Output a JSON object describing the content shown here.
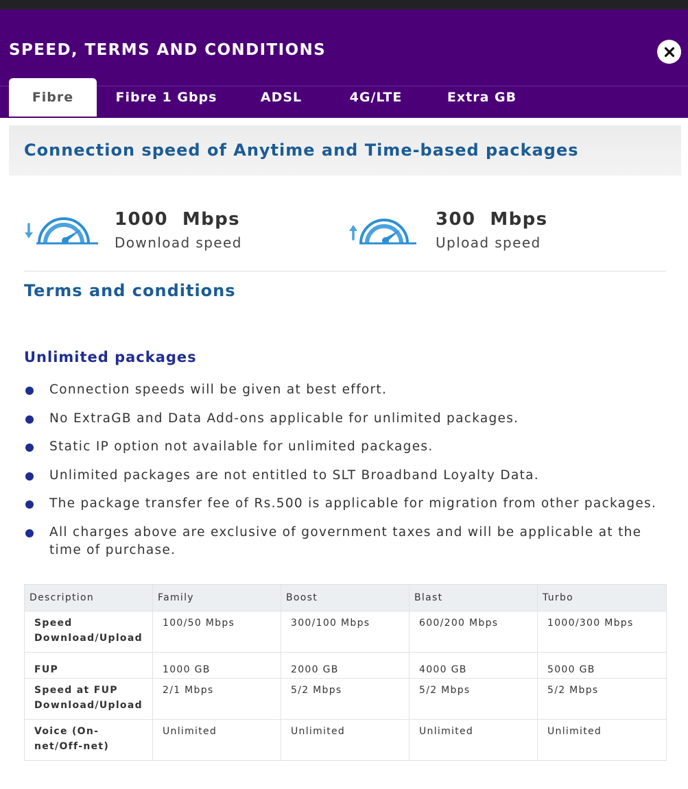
{
  "header": {
    "title": "SPEED, TERMS AND CONDITIONS",
    "close_label": "×"
  },
  "tabs": [
    {
      "label": "Fibre",
      "active": true
    },
    {
      "label": "Fibre 1 Gbps",
      "active": false
    },
    {
      "label": "ADSL",
      "active": false
    },
    {
      "label": "4G/LTE",
      "active": false
    },
    {
      "label": "Extra GB",
      "active": false
    }
  ],
  "section": {
    "heading": "Connection speed of Anytime and Time-based packages"
  },
  "speeds": {
    "download": {
      "value": "1000  Mbps",
      "label": "Download speed",
      "icon": "download-speed-gauge-icon"
    },
    "upload": {
      "value": "300  Mbps",
      "label": "Upload speed",
      "icon": "upload-speed-gauge-icon"
    }
  },
  "terms": {
    "title": "Terms and conditions",
    "unlimited_title": "Unlimited packages",
    "bullets": [
      "Connection speeds will be given at best effort.",
      "No ExtraGB and Data Add-ons applicable for unlimited packages.",
      "Static IP option not available for unlimited packages.",
      "Unlimited packages are not entitled to SLT Broadband Loyalty Data.",
      "The package transfer fee of Rs.500 is applicable for migration from other packages.",
      "All charges above are exclusive of government taxes and will be applicable at the time of purchase."
    ]
  },
  "table": {
    "headers": [
      "Description",
      "Family",
      "Boost",
      "Blast",
      "Turbo"
    ],
    "rows": [
      [
        "Speed Download/Upload",
        "100/50 Mbps",
        "300/100 Mbps",
        "600/200 Mbps",
        "1000/300 Mbps"
      ],
      [
        "FUP",
        "1000 GB",
        "2000 GB",
        "4000 GB",
        "5000 GB"
      ],
      [
        "Speed at FUP Download/Upload",
        "2/1 Mbps",
        "5/2 Mbps",
        "5/2 Mbps",
        "5/2 Mbps"
      ],
      [
        "Voice (On-net/Off-net)",
        "Unlimited",
        "Unlimited",
        "Unlimited",
        "Unlimited"
      ]
    ]
  },
  "colors": {
    "header_bg": "#4b0078",
    "heading_blue": "#1b5c95",
    "bullet_blue": "#1f2d92",
    "gauge_blue": "#2d8fd4"
  }
}
